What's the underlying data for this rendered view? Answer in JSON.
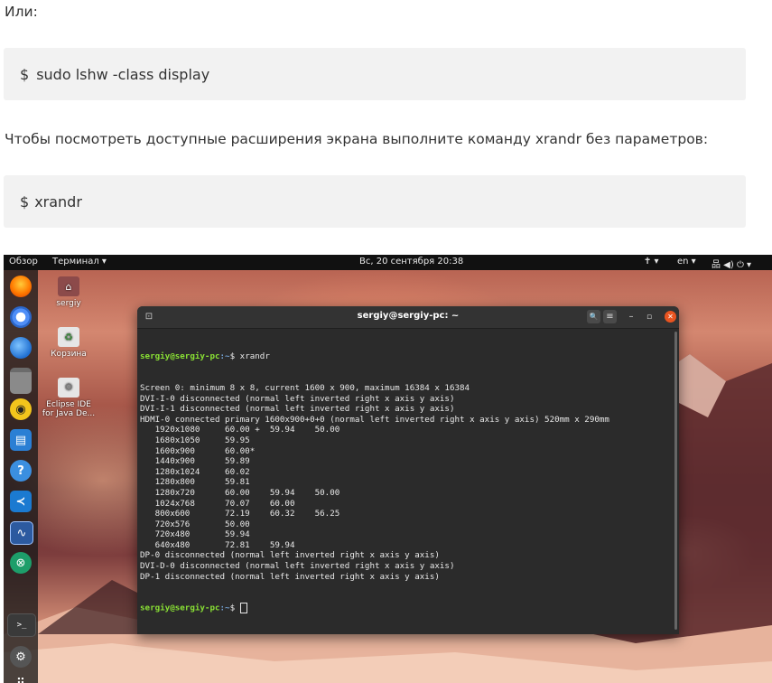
{
  "article": {
    "line1": "Или:",
    "cmd1_prompt": "$",
    "cmd1": "sudo lshw -class display",
    "line2": "Чтобы посмотреть доступные расширения экрана выполните команду xrandr без параметров:",
    "cmd2_prompt": "$",
    "cmd2": "xrandr"
  },
  "topbar": {
    "overview": "Обзор",
    "terminal_menu": "Терминал ▾",
    "datetime": "Вс, 20 сентября  20:38",
    "accessibility": "✝ ▾",
    "lang": "en ▾",
    "system": "品 ◀) ⏻ ▾"
  },
  "desktop": {
    "icons": [
      {
        "label": "sergiy",
        "glyph": "⌂"
      },
      {
        "label": "Корзина",
        "glyph": "♻"
      },
      {
        "label": "Eclipse IDE for Java De...",
        "glyph": "⚙"
      }
    ]
  },
  "dock": {
    "icons": [
      "firefox-icon",
      "chromium-icon",
      "thunderbird-icon",
      "files-icon",
      "rhythmbox-icon",
      "writer-icon",
      "help-icon",
      "vscode-icon",
      "monitor-icon",
      "settings-icon",
      "terminal-icon",
      "gear-icon",
      "apps-grid-icon"
    ],
    "glyphs": [
      "",
      "",
      "",
      "",
      "◉",
      "▤",
      "?",
      "≺",
      "∿",
      "⊗",
      ">_",
      "⚙",
      "⠿"
    ]
  },
  "terminal": {
    "title": "sergiy@sergiy-pc: ~",
    "search": "🔍",
    "menu": "≡",
    "minimize": "–",
    "maximize": "▫",
    "close": "✕",
    "tab_icon": "⊡",
    "prompt_user": "sergiy@sergiy-pc",
    "prompt_path": ":~",
    "prompt_symbol": "$ ",
    "command": "xrandr",
    "output": [
      "Screen 0: minimum 8 x 8, current 1600 x 900, maximum 16384 x 16384",
      "DVI-I-0 disconnected (normal left inverted right x axis y axis)",
      "DVI-I-1 disconnected (normal left inverted right x axis y axis)",
      "HDMI-0 connected primary 1600x900+0+0 (normal left inverted right x axis y axis) 520mm x 290mm",
      "   1920x1080     60.00 +  59.94    50.00",
      "   1680x1050     59.95",
      "   1600x900      60.00*",
      "   1440x900      59.89",
      "   1280x1024     60.02",
      "   1280x800      59.81",
      "   1280x720      60.00    59.94    50.00",
      "   1024x768      70.07    60.00",
      "   800x600       72.19    60.32    56.25",
      "   720x576       50.00",
      "   720x480       59.94",
      "   640x480       72.81    59.94",
      "DP-0 disconnected (normal left inverted right x axis y axis)",
      "DVI-D-0 disconnected (normal left inverted right x axis y axis)",
      "DP-1 disconnected (normal left inverted right x axis y axis)"
    ]
  }
}
